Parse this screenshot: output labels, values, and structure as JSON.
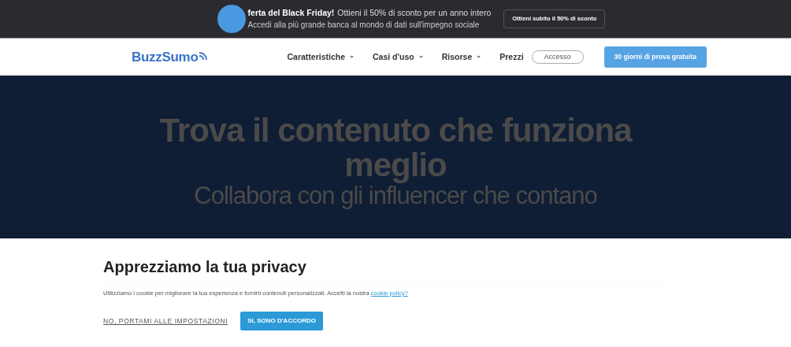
{
  "promo": {
    "headline": "ferta del Black Friday!",
    "offer": "Ottieni il 50% di sconto per un anno intero",
    "subtitle": "Accedi alla più grande banca al mondo di dati sull'impegno sociale",
    "button": "Ottieni subito il 50% di sconto"
  },
  "navbar": {
    "logo": "BuzzSumo",
    "items": [
      {
        "label": "Caratteristiche",
        "kind": "dropdown"
      },
      {
        "label": "Casi d'uso",
        "kind": "dropdown"
      },
      {
        "label": "Risorse",
        "kind": "dropdown"
      },
      {
        "label": "Prezzi",
        "kind": "link"
      }
    ],
    "login": "Accesso",
    "trial": "30 giorni di prova gratuita"
  },
  "hero": {
    "title": "Trova il contenuto che funziona meglio",
    "subtitle": "Collabora con gli influencer che contano"
  },
  "cookie_banner": {
    "title": "Apprezziamo la tua privacy",
    "text": "Utilizziamo i cookie per migliorare la tua esperienza e fornirti contenuti personalizzati. Accetti la nostra",
    "link": "cookie policy?",
    "decline": "NO, PORTAMI ALLE IMPOSTAZIONI",
    "accept": "SI, SONO D'ACCORDO"
  }
}
